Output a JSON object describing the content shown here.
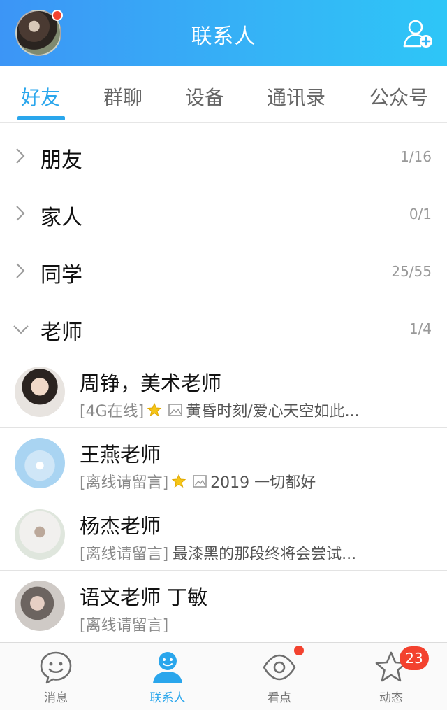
{
  "header": {
    "title": "联系人"
  },
  "tabs": [
    {
      "label": "好友",
      "active": true
    },
    {
      "label": "群聊"
    },
    {
      "label": "设备"
    },
    {
      "label": "通讯录"
    },
    {
      "label": "公众号"
    }
  ],
  "groups": [
    {
      "name": "朋友",
      "count": "1/16",
      "expanded": false
    },
    {
      "name": "家人",
      "count": "0/1",
      "expanded": false
    },
    {
      "name": "同学",
      "count": "25/55",
      "expanded": false
    },
    {
      "name": "老师",
      "count": "1/4",
      "expanded": true
    }
  ],
  "contacts": [
    {
      "name": "周铮，美术老师",
      "status": "[4G在线]",
      "star": true,
      "photo": true,
      "signature": "黄昏时刻/爱心天空如此..."
    },
    {
      "name": "王燕老师",
      "status": "[离线请留言]",
      "star": true,
      "photo": true,
      "signature": "2019 一切都好"
    },
    {
      "name": "杨杰老师",
      "status": "[离线请留言]",
      "star": false,
      "photo": false,
      "signature": "最漆黑的那段终将会尝试..."
    },
    {
      "name": "语文老师 丁敏",
      "status": "[离线请留言]",
      "star": false,
      "photo": false,
      "signature": ""
    }
  ],
  "bottom_nav": [
    {
      "label": "消息",
      "icon": "message-icon"
    },
    {
      "label": "联系人",
      "icon": "contacts-icon",
      "active": true
    },
    {
      "label": "看点",
      "icon": "eye-icon",
      "dot": true
    },
    {
      "label": "动态",
      "icon": "star-icon",
      "badge": "23"
    }
  ],
  "colors": {
    "accent": "#2aa6ec",
    "header_start": "#3c95f6",
    "header_end": "#2ec6f7",
    "badge": "#f3422f"
  }
}
